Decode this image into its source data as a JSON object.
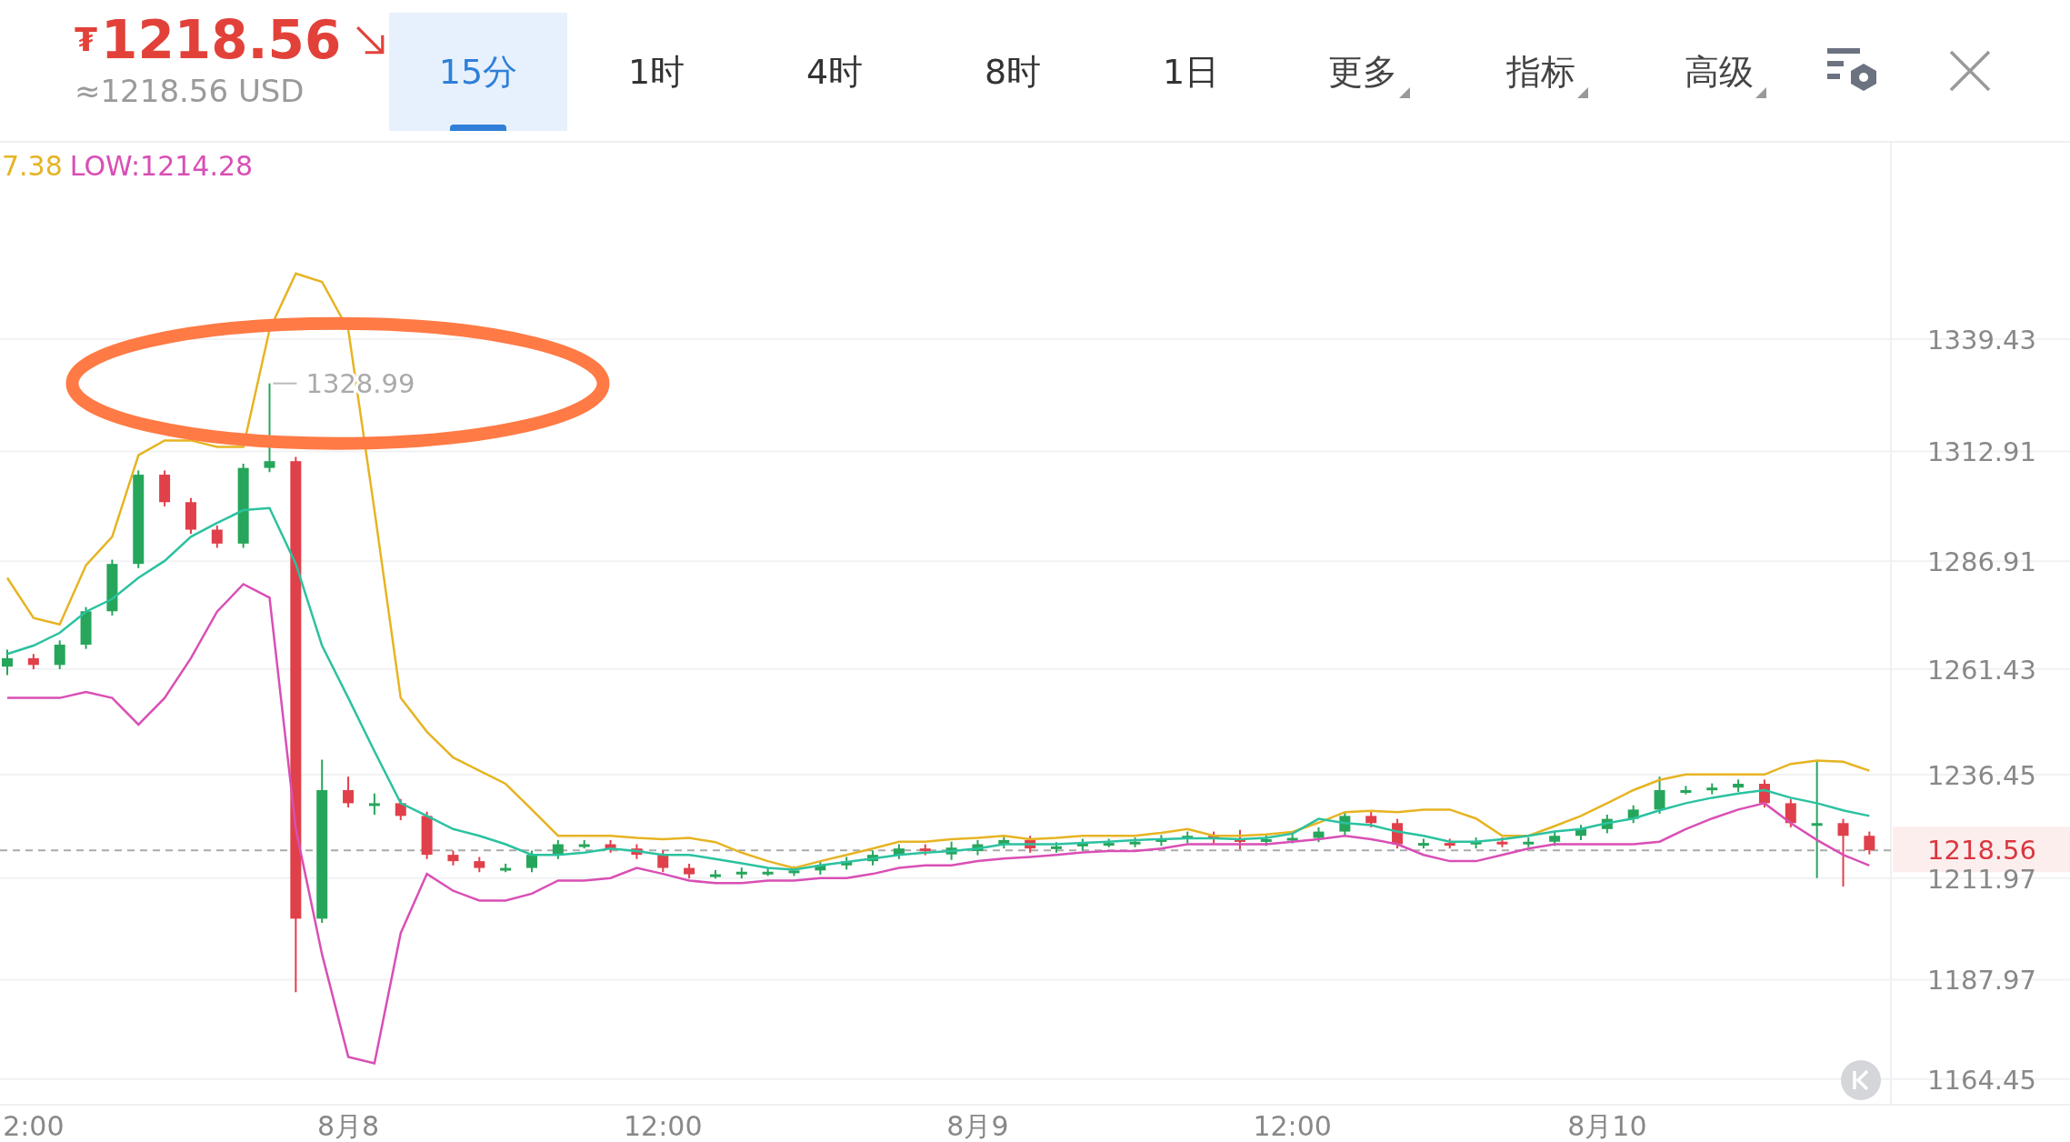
{
  "header": {
    "currency_symbol": "₮",
    "price": "1218.56",
    "converted": "≈1218.56 USD"
  },
  "tabs": [
    {
      "label": "15分",
      "selected": true
    },
    {
      "label": "1时",
      "selected": false
    },
    {
      "label": "4时",
      "selected": false
    },
    {
      "label": "8时",
      "selected": false
    },
    {
      "label": "1日",
      "selected": false
    }
  ],
  "menus": [
    {
      "label": "更多"
    },
    {
      "label": "指标"
    },
    {
      "label": "高级"
    }
  ],
  "legend": [
    {
      "text": "7.38",
      "color": "#e6b422"
    },
    {
      "text": "LOW:1214.28",
      "color": "#d94fb5"
    }
  ],
  "chart": {
    "highlight": {
      "color": "#ff7a45"
    },
    "chart_data": {
      "type": "candlestick",
      "categories": [
        null,
        "2:00",
        null,
        null,
        null,
        null,
        null,
        null,
        null,
        null,
        null,
        null,
        null,
        "8月8",
        null,
        null,
        null,
        null,
        null,
        null,
        null,
        null,
        null,
        null,
        null,
        "12:00",
        null,
        null,
        null,
        null,
        null,
        null,
        null,
        null,
        null,
        null,
        null,
        "8月9",
        null,
        null,
        null,
        null,
        null,
        null,
        null,
        null,
        null,
        null,
        null,
        "12:00",
        null,
        null,
        null,
        null,
        null,
        null,
        null,
        null,
        null,
        null,
        null,
        "8月10",
        null,
        null,
        null,
        null,
        null,
        null,
        null,
        null,
        null,
        null
      ],
      "ylim": [
        1158.4,
        1385.9
      ],
      "grid": true,
      "yticks": [
        1339.43,
        1312.91,
        1286.91,
        1261.43,
        1236.45,
        1211.97,
        1187.97,
        1164.45
      ],
      "ohlc": [
        [
          1262,
          1266,
          1260,
          1264
        ],
        [
          1264,
          1265,
          1261.4,
          1262.4
        ],
        [
          1262.4,
          1268.2,
          1261.4,
          1267.2
        ],
        [
          1267.2,
          1276.1,
          1266.2,
          1275.1
        ],
        [
          1275.1,
          1287.3,
          1274.1,
          1286.3
        ],
        [
          1286.3,
          1308.4,
          1285.3,
          1307.4
        ],
        [
          1307.4,
          1308.4,
          1299.9,
          1300.9
        ],
        [
          1300.9,
          1301.9,
          1293.4,
          1294.4
        ],
        [
          1294.4,
          1295.4,
          1290.1,
          1291.1
        ],
        [
          1291.1,
          1310,
          1290.1,
          1309
        ],
        [
          1309,
          1328.99,
          1308,
          1310.6
        ],
        [
          1310.6,
          1311.6,
          1185,
          1202.4
        ],
        [
          1202.4,
          1240,
          1201.4,
          1232.8
        ],
        [
          1232.8,
          1236,
          1228.7,
          1229.7
        ],
        [
          1229.7,
          1232,
          1227,
          1229.7
        ],
        [
          1229.7,
          1230.7,
          1225.7,
          1226.7
        ],
        [
          1226.7,
          1227.7,
          1216.5,
          1217.5
        ],
        [
          1217.5,
          1218.5,
          1215,
          1216
        ],
        [
          1216,
          1217,
          1213.4,
          1214.4
        ],
        [
          1214.4,
          1215.4,
          1213.4,
          1214.4
        ],
        [
          1214.4,
          1218.5,
          1213.4,
          1217.5
        ],
        [
          1217.5,
          1221,
          1216.5,
          1220
        ],
        [
          1220,
          1221,
          1219,
          1220
        ],
        [
          1220,
          1221,
          1218,
          1219
        ],
        [
          1219,
          1220,
          1216.5,
          1217.5
        ],
        [
          1217.5,
          1218.5,
          1213.4,
          1214.4
        ],
        [
          1214.4,
          1215.4,
          1211.9,
          1212.9
        ],
        [
          1212.9,
          1213.9,
          1211.9,
          1212.9
        ],
        [
          1212.9,
          1214.5,
          1211.9,
          1213.5
        ],
        [
          1213.5,
          1214.5,
          1212.5,
          1213.5
        ],
        [
          1213.5,
          1214.8,
          1212.5,
          1213.8
        ],
        [
          1213.8,
          1216,
          1212.8,
          1215
        ],
        [
          1215,
          1217,
          1214,
          1216
        ],
        [
          1216,
          1218.5,
          1215,
          1217.5
        ],
        [
          1217.5,
          1220,
          1216.5,
          1219
        ],
        [
          1219,
          1220,
          1217.4,
          1218.4
        ],
        [
          1217.6,
          1220.6,
          1216.3,
          1219.2
        ],
        [
          1218.4,
          1221,
          1217.4,
          1220
        ],
        [
          1220,
          1222,
          1219,
          1221
        ],
        [
          1221,
          1222,
          1218,
          1219
        ],
        [
          1219,
          1220.5,
          1218,
          1219.5
        ],
        [
          1219.5,
          1221.3,
          1218.5,
          1220.3
        ],
        [
          1220.3,
          1221.3,
          1219.3,
          1220.3
        ],
        [
          1220.3,
          1221.6,
          1219.3,
          1220.6
        ],
        [
          1220.6,
          1222.2,
          1219.6,
          1221.2
        ],
        [
          1221.2,
          1223,
          1220.2,
          1222
        ],
        [
          1222,
          1223,
          1220.2,
          1221.2
        ],
        [
          1221.2,
          1223.4,
          1218.8,
          1220.6
        ],
        [
          1220.6,
          1222.2,
          1219.6,
          1221.2
        ],
        [
          1221.2,
          1222.5,
          1220.2,
          1221.5
        ],
        [
          1221.5,
          1224,
          1220.5,
          1223
        ],
        [
          1223,
          1227.7,
          1222,
          1226.7
        ],
        [
          1226.7,
          1227.7,
          1224,
          1225
        ],
        [
          1225,
          1226,
          1219,
          1220
        ],
        [
          1220,
          1221.3,
          1219,
          1220.3
        ],
        [
          1220.3,
          1221.3,
          1219,
          1220
        ],
        [
          1220,
          1221.6,
          1219,
          1220.6
        ],
        [
          1220.6,
          1221.6,
          1219.3,
          1220.3
        ],
        [
          1220.3,
          1221.6,
          1219.3,
          1220.6
        ],
        [
          1220.6,
          1223,
          1219.6,
          1222
        ],
        [
          1222,
          1224.6,
          1221,
          1223.6
        ],
        [
          1223.6,
          1227,
          1222.6,
          1226
        ],
        [
          1226,
          1229.2,
          1225,
          1228.2
        ],
        [
          1228.2,
          1236,
          1227.2,
          1232.8
        ],
        [
          1232.8,
          1233.8,
          1231.8,
          1232.8
        ],
        [
          1232.8,
          1234.4,
          1231.8,
          1233.4
        ],
        [
          1233.4,
          1235.3,
          1232.4,
          1234.3
        ],
        [
          1234.3,
          1235.3,
          1228.7,
          1229.7
        ],
        [
          1229.7,
          1230.7,
          1224,
          1225
        ],
        [
          1225,
          1239.5,
          1212,
          1225
        ],
        [
          1225,
          1226,
          1210,
          1222
        ],
        [
          1222,
          1223,
          1217.6,
          1218.6
        ]
      ],
      "series": [
        {
          "type": "line",
          "color": "#e6b422",
          "values": [
            1283,
            1273.5,
            1272,
            1286,
            1292.7,
            1312,
            1315.5,
            1315.5,
            1314,
            1314,
            1341.7,
            1355,
            1353,
            1341.7,
            1299,
            1254.6,
            1246.6,
            1240.5,
            1237.4,
            1234.3,
            1228.2,
            1222,
            1222,
            1222,
            1221.5,
            1221.2,
            1221.5,
            1220.5,
            1218,
            1216,
            1214.4,
            1216,
            1217.5,
            1219,
            1220.6,
            1220.6,
            1221.2,
            1221.5,
            1222,
            1221.2,
            1221.5,
            1222,
            1222,
            1222,
            1222.7,
            1223.6,
            1222,
            1222,
            1222.3,
            1222.9,
            1225.1,
            1227.6,
            1227.9,
            1227.6,
            1228.2,
            1228.2,
            1226.1,
            1222,
            1222,
            1224.3,
            1226.7,
            1229.7,
            1232.8,
            1235.2,
            1236.5,
            1236.5,
            1236.5,
            1236.5,
            1239,
            1239.8,
            1239.5,
            1237.4
          ]
        },
        {
          "type": "line",
          "color": "#2bc2a0",
          "values": [
            1265,
            1267,
            1270,
            1275,
            1278,
            1283,
            1287,
            1292.7,
            1296,
            1299,
            1299.5,
            1286.3,
            1267,
            1254.6,
            1242,
            1229.7,
            1226.7,
            1223.6,
            1222,
            1220,
            1217.5,
            1217.5,
            1218,
            1219,
            1218.4,
            1217.5,
            1217.5,
            1216.5,
            1215.5,
            1214.4,
            1214,
            1215,
            1215.8,
            1216.6,
            1217.5,
            1218,
            1218.4,
            1219,
            1220,
            1220,
            1220,
            1220.3,
            1220.6,
            1221,
            1221.2,
            1221.4,
            1221.4,
            1221.2,
            1221.5,
            1222.5,
            1226,
            1225,
            1224.5,
            1223,
            1222,
            1220.6,
            1220.6,
            1221.2,
            1222,
            1223,
            1223.6,
            1225,
            1226.1,
            1228,
            1229.7,
            1231,
            1232,
            1232.8,
            1231,
            1229.7,
            1228,
            1226.7
          ]
        },
        {
          "type": "line",
          "color": "#d94fb5",
          "values": [
            1254.6,
            1254.6,
            1254.6,
            1256,
            1254.6,
            1248.3,
            1254.6,
            1264,
            1275,
            1281.5,
            1278.3,
            1223.6,
            1194,
            1169.7,
            1168.2,
            1199,
            1213,
            1209,
            1206.7,
            1206.7,
            1208.3,
            1211.4,
            1211.4,
            1212,
            1214.4,
            1213,
            1211.4,
            1210.8,
            1210.8,
            1211.4,
            1211.4,
            1212,
            1212,
            1213,
            1214.4,
            1215,
            1215,
            1216,
            1216.6,
            1217,
            1217.5,
            1218.1,
            1218.4,
            1218.4,
            1219,
            1220,
            1220,
            1220,
            1220,
            1220.6,
            1221.2,
            1222,
            1221.2,
            1220,
            1217.5,
            1216,
            1216,
            1217.5,
            1219,
            1220,
            1220,
            1220,
            1220,
            1220.6,
            1223.6,
            1226.1,
            1228.2,
            1229.7,
            1225,
            1221,
            1217.5,
            1215
          ]
        }
      ],
      "annotations": [
        "1328.99"
      ],
      "ref_lines": [
        {
          "axis": "y",
          "value": 1218.56,
          "label": "1218.56"
        }
      ]
    }
  }
}
